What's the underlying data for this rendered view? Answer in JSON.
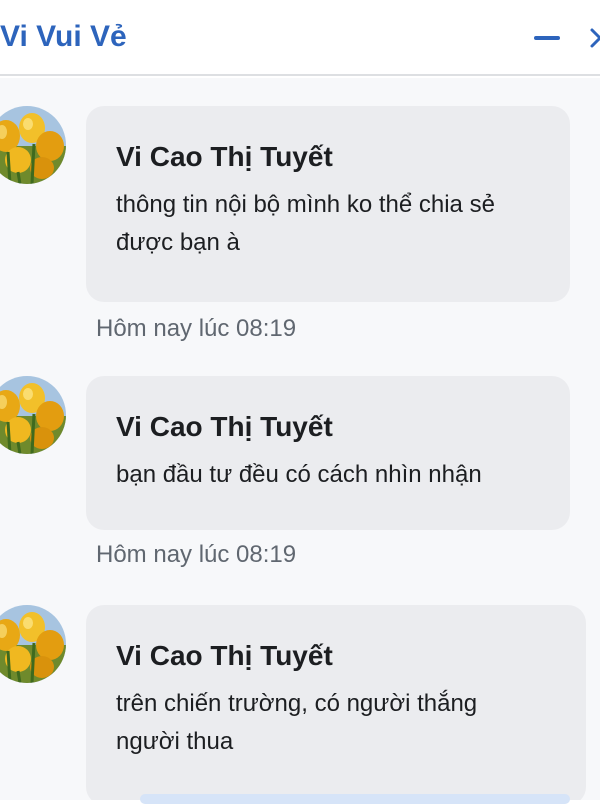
{
  "header": {
    "title": "Vi Vui Vẻ",
    "minimize_icon": "minimize-icon",
    "close_icon": "close-icon"
  },
  "messages": [
    {
      "sender": "Vi Cao Thị Tuyết",
      "text": "thông tin nội bộ mình ko thể chia sẻ được bạn à",
      "time": "Hôm nay lúc 08:19",
      "avatar_icon": "yellow-tulips-avatar"
    },
    {
      "sender": "Vi Cao Thị Tuyết",
      "text": "bạn đầu tư đều có cách nhìn nhận",
      "time": "Hôm nay lúc 08:19",
      "avatar_icon": "yellow-tulips-avatar"
    },
    {
      "sender": "Vi Cao Thị Tuyết",
      "text": "trên chiến trường, có người thắng người thua",
      "time": "",
      "avatar_icon": "yellow-tulips-avatar"
    }
  ],
  "colors": {
    "accent": "#2d64bc",
    "bubble": "#ebecef",
    "background": "#f7f8fa",
    "timestamp": "#606770"
  }
}
